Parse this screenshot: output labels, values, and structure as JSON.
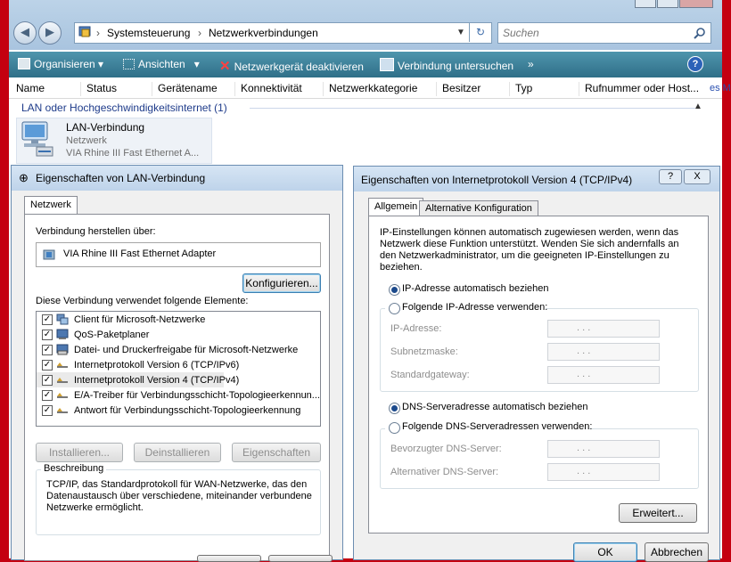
{
  "explorer": {
    "breadcrumb": [
      "Systemsteuerung",
      "Netzwerkverbindungen"
    ],
    "search_placeholder": "Suchen",
    "toolbar": {
      "organize": "Organisieren",
      "views": "Ansichten",
      "disable": "Netzwerkgerät deaktivieren",
      "diagnose": "Verbindung untersuchen",
      "more": "»"
    },
    "columns": [
      "Name",
      "Status",
      "Gerätename",
      "Konnektivität",
      "Netzwerkkategorie",
      "Besitzer",
      "Typ",
      "Rufnummer oder Host..."
    ],
    "group_label": "LAN oder Hochgeschwindigkeitsinternet (1)",
    "item": {
      "name": "LAN-Verbindung",
      "category": "Netzwerk",
      "device": "VIA Rhine III Fast Ethernet A..."
    },
    "right_edge_link": "es M"
  },
  "lan_dialog": {
    "title": "Eigenschaften von LAN-Verbindung",
    "tab": "Netzwerk",
    "connect_using_label": "Verbindung herstellen über:",
    "adapter": "VIA Rhine III Fast Ethernet Adapter",
    "configure_button": "Konfigurieren...",
    "items_label": "Diese Verbindung verwendet folgende Elemente:",
    "items": [
      {
        "label": "Client für Microsoft-Netzwerke",
        "checked": true
      },
      {
        "label": "QoS-Paketplaner",
        "checked": true
      },
      {
        "label": "Datei- und Druckerfreigabe für Microsoft-Netzwerke",
        "checked": true
      },
      {
        "label": "Internetprotokoll Version 6 (TCP/IPv6)",
        "checked": true
      },
      {
        "label": "Internetprotokoll Version 4 (TCP/IPv4)",
        "checked": true
      },
      {
        "label": "E/A-Treiber für Verbindungsschicht-Topologieerkennun...",
        "checked": true
      },
      {
        "label": "Antwort für Verbindungsschicht-Topologieerkennung",
        "checked": true
      }
    ],
    "install_button": "Installieren...",
    "uninstall_button": "Deinstallieren",
    "properties_button": "Eigenschaften",
    "description_label": "Beschreibung",
    "description": "TCP/IP, das Standardprotokoll für WAN-Netzwerke, das den Datenaustausch über verschiedene, miteinander verbundene Netzwerke ermöglicht."
  },
  "ipv4_dialog": {
    "title": "Eigenschaften von Internetprotokoll Version 4 (TCP/IPv4)",
    "help": "?",
    "close": "X",
    "tab_general": "Allgemein",
    "tab_alternate": "Alternative Konfiguration",
    "intro": "IP-Einstellungen können automatisch zugewiesen werden, wenn das Netzwerk diese Funktion unterstützt. Wenden Sie sich andernfalls an den Netzwerkadministrator, um die geeigneten IP-Einstellungen zu beziehen.",
    "ip_auto": "IP-Adresse automatisch beziehen",
    "ip_manual": "Folgende IP-Adresse verwenden:",
    "ip_address_label": "IP-Adresse:",
    "subnet_label": "Subnetzmaske:",
    "gateway_label": "Standardgateway:",
    "dns_auto": "DNS-Serveradresse automatisch beziehen",
    "dns_manual": "Folgende DNS-Serveradressen verwenden:",
    "preferred_dns_label": "Bevorzugter DNS-Server:",
    "alternate_dns_label": "Alternativer DNS-Server:",
    "ip_placeholder": ".   .   .",
    "advanced_button": "Erweitert...",
    "ok_button": "OK",
    "cancel_button": "Abbrechen"
  }
}
